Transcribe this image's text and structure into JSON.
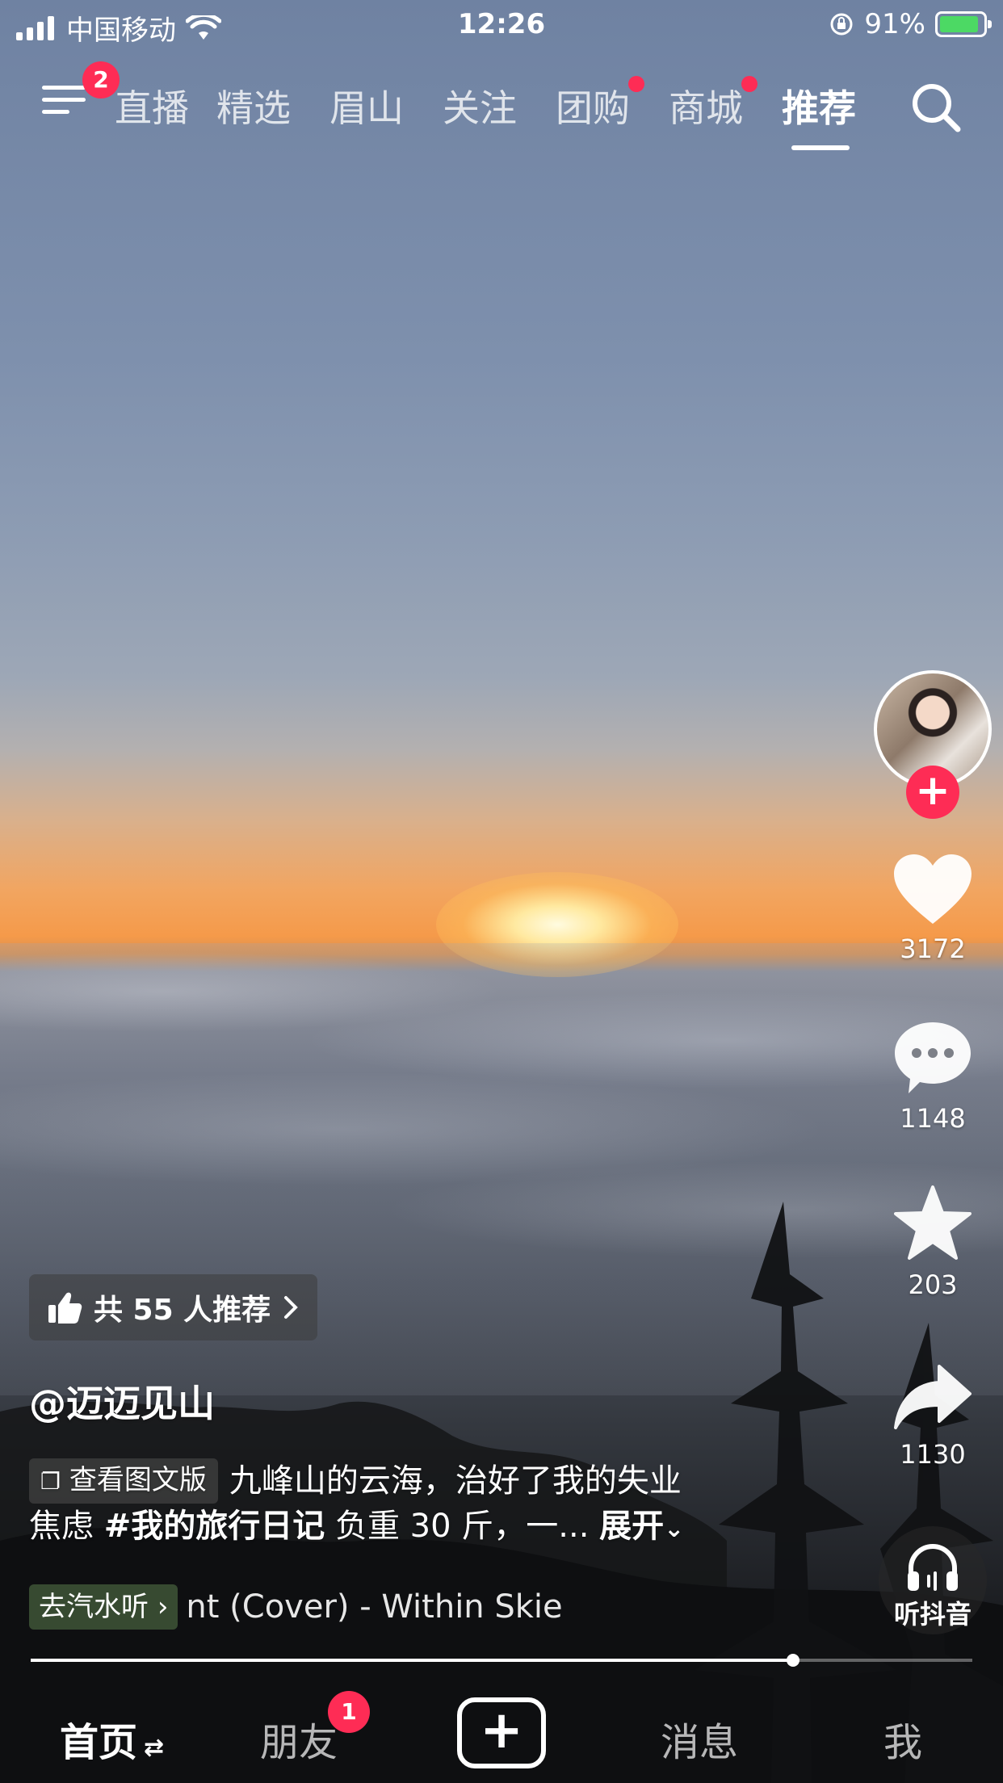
{
  "status_bar": {
    "carrier": "中国移动",
    "time": "12:26",
    "battery": "91%",
    "battery_level": 0.91
  },
  "top_nav": {
    "menu_badge": "2",
    "tabs": [
      {
        "label": "直播"
      },
      {
        "label": "精选"
      },
      {
        "label": "眉山"
      },
      {
        "label": "关注"
      },
      {
        "label": "团购"
      },
      {
        "label": "商城"
      },
      {
        "label": "推荐"
      }
    ],
    "active_tab": "推荐"
  },
  "actions": {
    "like_count": "3172",
    "comment_count": "1148",
    "favorite_count": "203",
    "share_count": "1130",
    "listen_label": "听抖音"
  },
  "post": {
    "recommend_text": "共 55 人推荐",
    "author": "@迈迈见山",
    "view_text_chip": "查看图文版",
    "desc_line1": "九峰山的云海，治好了我的失业",
    "desc_line2_prefix": "焦虑 ",
    "hashtag": "#我的旅行日记",
    "desc_line2_suffix": " 负重 30 斤，一... ",
    "expand_label": "展开"
  },
  "music": {
    "go_label": "去汽水听",
    "song": "nt (Cover) - Within Skie"
  },
  "playback": {
    "progress": 0.81
  },
  "bottom_nav": {
    "home": "首页",
    "friends": "朋友",
    "friends_badge": "1",
    "messages": "消息",
    "me": "我"
  },
  "colors": {
    "accent": "#fe2c55",
    "battery_fill": "#4cd964"
  }
}
